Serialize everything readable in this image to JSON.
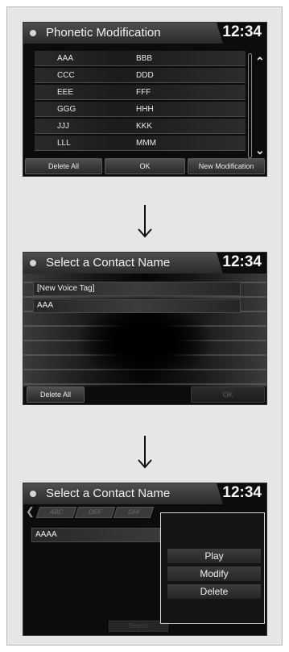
{
  "screens": [
    {
      "title": "Phonetic Modification",
      "time": "12:34",
      "rows": [
        {
          "name": "AAA",
          "phonetic": "BBB"
        },
        {
          "name": "CCC",
          "phonetic": "DDD"
        },
        {
          "name": "EEE",
          "phonetic": "FFF"
        },
        {
          "name": "GGG",
          "phonetic": "HHH"
        },
        {
          "name": "JJJ",
          "phonetic": "KKK"
        },
        {
          "name": "LLL",
          "phonetic": "MMM"
        }
      ],
      "buttons": {
        "delete_all": "Delete All",
        "ok": "OK",
        "new_modification": "New Modification"
      }
    },
    {
      "title": "Select a Contact Name",
      "time": "12:34",
      "rows": [
        "[New Voice Tag]",
        "AAA"
      ],
      "buttons": {
        "delete_all": "Delete All",
        "ok": "OK"
      }
    },
    {
      "title": "Select a Contact Name",
      "time": "12:34",
      "tabs": [
        "ABC",
        "DEF",
        "GHI"
      ],
      "rows": [
        "AAAA"
      ],
      "popup": [
        "Play",
        "Modify",
        "Delete"
      ],
      "search_label": "Search"
    }
  ],
  "icons": {
    "arrow": "down-arrow-icon",
    "scroll_up": "double-chevron-up-icon",
    "scroll_down": "double-chevron-down-icon",
    "title_dot": "dot-icon",
    "back": "back-chevron-icon"
  },
  "colors": {
    "screen_bg": "#0c0c0c",
    "text": "#f0f0f0",
    "panel_bg": "#e6e6e6"
  }
}
